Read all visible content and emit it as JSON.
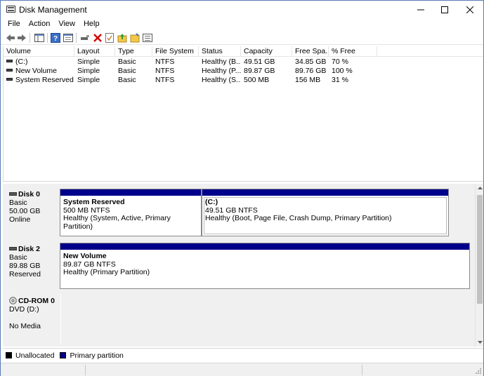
{
  "window": {
    "title": "Disk Management"
  },
  "menu": [
    {
      "label": "File"
    },
    {
      "label": "Action"
    },
    {
      "label": "View"
    },
    {
      "label": "Help"
    }
  ],
  "toolbar": {
    "buttons": [
      "back-icon",
      "forward-icon",
      "console-tree-icon",
      "help-icon",
      "properties-icon",
      "connect-icon",
      "delete-icon",
      "check-icon",
      "folder-up-icon",
      "folder-open-icon",
      "list-view-icon"
    ]
  },
  "volume_list": {
    "columns": [
      "Volume",
      "Layout",
      "Type",
      "File System",
      "Status",
      "Capacity",
      "Free Spa...",
      "% Free"
    ],
    "rows": [
      {
        "volume": "(C:)",
        "layout": "Simple",
        "type": "Basic",
        "fs": "NTFS",
        "status": "Healthy (B...",
        "capacity": "49.51 GB",
        "free": "34.85 GB",
        "pct": "70 %"
      },
      {
        "volume": "New Volume",
        "layout": "Simple",
        "type": "Basic",
        "fs": "NTFS",
        "status": "Healthy (P...",
        "capacity": "89.87 GB",
        "free": "89.76 GB",
        "pct": "100 %"
      },
      {
        "volume": "System Reserved",
        "layout": "Simple",
        "type": "Basic",
        "fs": "NTFS",
        "status": "Healthy (S...",
        "capacity": "500 MB",
        "free": "156 MB",
        "pct": "31 %"
      }
    ]
  },
  "disks": [
    {
      "name": "Disk 0",
      "type": "Basic",
      "size": "50.00 GB",
      "state": "Online",
      "partitions": [
        {
          "name": "System Reserved",
          "size": "500 MB NTFS",
          "status": "Healthy (System, Active, Primary Partition)"
        },
        {
          "name": "(C:)",
          "size": "49.51 GB NTFS",
          "status": "Healthy (Boot, Page File, Crash Dump, Primary Partition)"
        }
      ]
    },
    {
      "name": "Disk 2",
      "type": "Basic",
      "size": "89.88 GB",
      "state": "Reserved",
      "partitions": [
        {
          "name": "New Volume",
          "size": "89.87 GB NTFS",
          "status": "Healthy (Primary Partition)"
        }
      ]
    },
    {
      "name": "CD-ROM 0",
      "type": "DVD (D:)",
      "size": "",
      "state": "No Media",
      "partitions": []
    }
  ],
  "legend": [
    {
      "label": "Unallocated",
      "color": "#000000"
    },
    {
      "label": "Primary partition",
      "color": "#00008b"
    }
  ],
  "colors": {
    "primary": "#00008b",
    "unallocated": "#000000"
  }
}
